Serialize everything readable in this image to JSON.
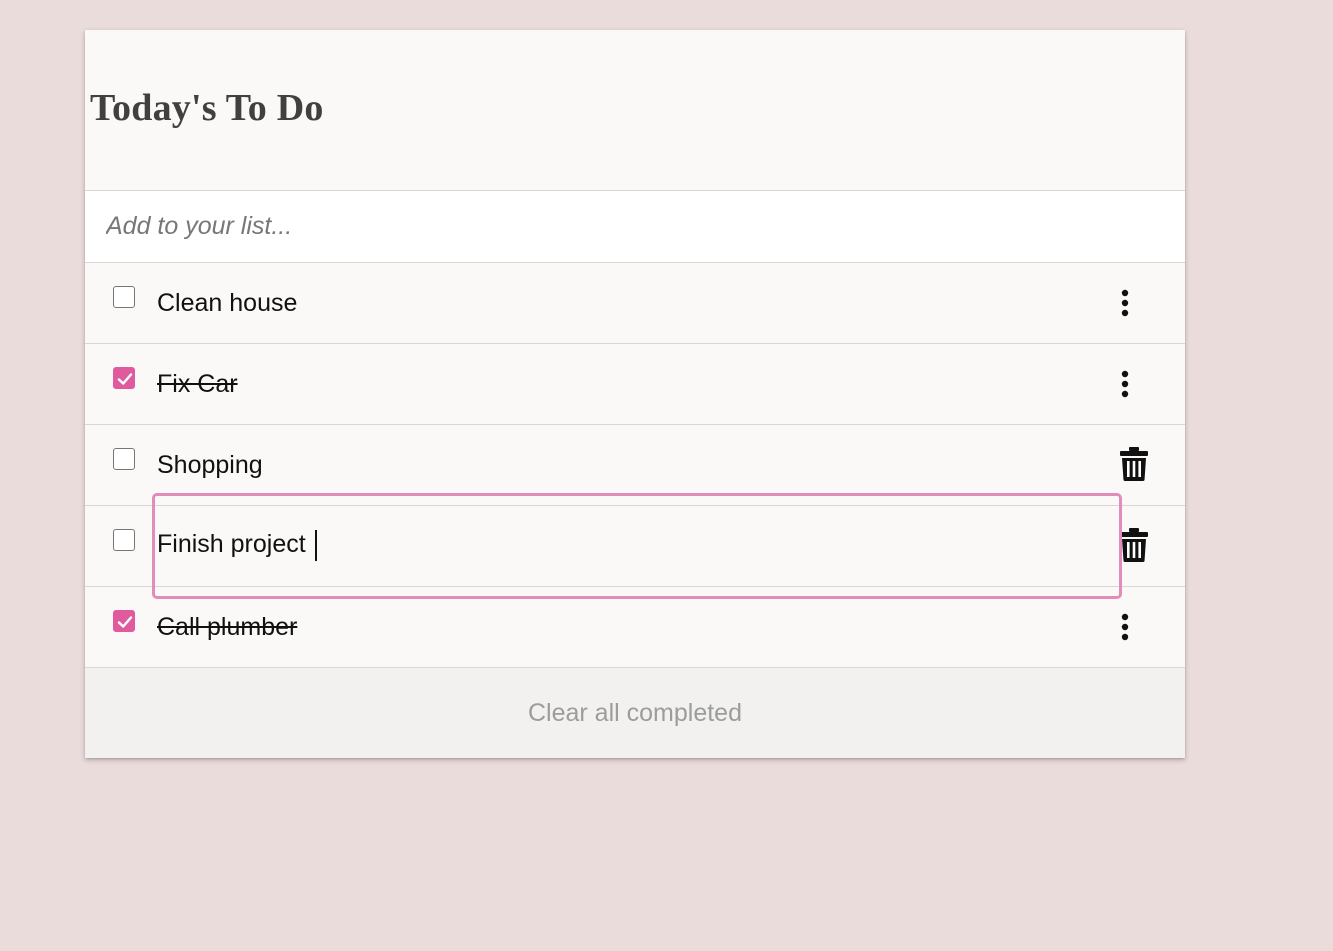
{
  "app": {
    "title": "Today's To Do"
  },
  "add_input": {
    "placeholder": "Add to your list...",
    "value": ""
  },
  "items": [
    {
      "label": "Clean house",
      "completed": false,
      "action_icon": "more-vertical-icon"
    },
    {
      "label": "Fix Car",
      "completed": true,
      "action_icon": "more-vertical-icon"
    },
    {
      "label": "Shopping",
      "completed": false,
      "action_icon": "trash-icon"
    },
    {
      "label": "Finish project",
      "completed": false,
      "action_icon": "trash-icon",
      "editing": true
    },
    {
      "label": "Call plumber",
      "completed": true,
      "action_icon": "more-vertical-icon"
    }
  ],
  "footer": {
    "clear_label": "Clear all completed"
  },
  "colors": {
    "background": "#eadcdb",
    "card": "#faf9f8",
    "accent": "#e05a9e",
    "focus_border": "#e18cba",
    "footer_text": "#9c9c9c"
  }
}
